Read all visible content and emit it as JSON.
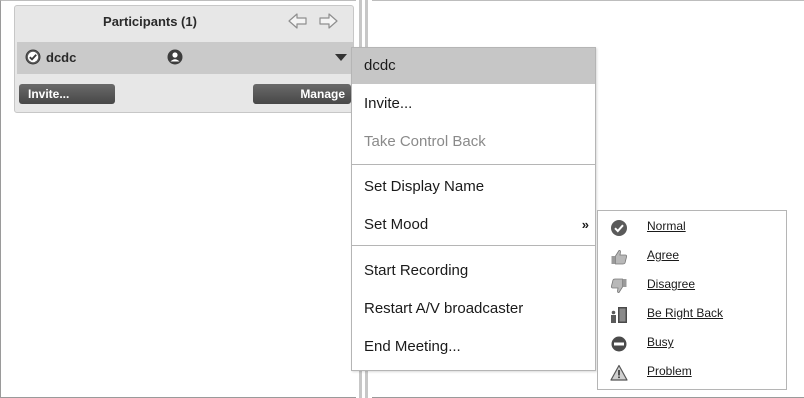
{
  "panel": {
    "title": "Participants (1)",
    "participant": {
      "name": "dcdc"
    },
    "invite_label": "Invite...",
    "manage_label": "Manage"
  },
  "context_menu": {
    "header": "dcdc",
    "items": [
      {
        "label": "Invite...",
        "enabled": true
      },
      {
        "label": "Take Control Back",
        "enabled": false
      },
      {
        "label": "Set Display Name",
        "enabled": true
      },
      {
        "label": "Set Mood",
        "enabled": true,
        "submenu_marker": "»"
      },
      {
        "label": "Start Recording",
        "enabled": true
      },
      {
        "label": "Restart A/V broadcaster",
        "enabled": true
      },
      {
        "label": "End Meeting...",
        "enabled": true
      }
    ]
  },
  "mood_submenu": {
    "items": [
      {
        "label": "Normal",
        "icon": "check-circle-icon"
      },
      {
        "label": "Agree",
        "icon": "thumbs-up-icon"
      },
      {
        "label": "Disagree",
        "icon": "thumbs-down-icon"
      },
      {
        "label": "Be Right Back",
        "icon": "door-exit-icon"
      },
      {
        "label": "Busy",
        "icon": "no-entry-icon"
      },
      {
        "label": "Problem",
        "icon": "warning-icon"
      }
    ]
  },
  "colors": {
    "panel_bg": "#e7e7e7",
    "row_bg": "#cacaca",
    "menu_header_bg": "#c6c6c6",
    "disabled_text": "#8a8a8a",
    "button_dark": "#4f4f4f"
  }
}
